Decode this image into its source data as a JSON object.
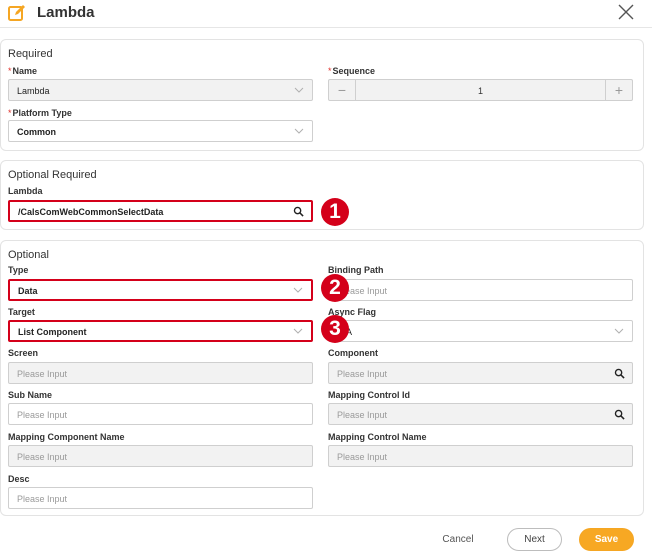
{
  "dialog": {
    "title": "Lambda"
  },
  "required": {
    "section_title": "Required",
    "name": {
      "label": "Name",
      "required_mark": "*",
      "value": "Lambda"
    },
    "sequence": {
      "label": "Sequence",
      "required_mark": "*",
      "value": "1",
      "minus": "−",
      "plus": "+"
    },
    "platform_type": {
      "label": "Platform Type",
      "required_mark": "*",
      "value": "Common"
    }
  },
  "optional_required": {
    "section_title": "Optional Required",
    "lambda": {
      "label": "Lambda",
      "value": "/CalsComWebCommonSelectData"
    }
  },
  "optional": {
    "section_title": "Optional",
    "type": {
      "label": "Type",
      "value": "Data"
    },
    "binding_path": {
      "label": "Binding Path",
      "placeholder": "Please Input"
    },
    "target": {
      "label": "Target",
      "value": "List Component"
    },
    "async_flag": {
      "label": "Async Flag",
      "value": "N/A"
    },
    "screen": {
      "label": "Screen",
      "placeholder": "Please Input"
    },
    "component": {
      "label": "Component",
      "placeholder": "Please Input"
    },
    "sub_name": {
      "label": "Sub Name",
      "placeholder": "Please Input"
    },
    "mapping_control_id": {
      "label": "Mapping Control Id",
      "placeholder": "Please Input"
    },
    "mapping_component_name": {
      "label": "Mapping Component Name",
      "placeholder": "Please Input"
    },
    "mapping_control_name": {
      "label": "Mapping Control Name",
      "placeholder": "Please Input"
    },
    "desc": {
      "label": "Desc",
      "placeholder": "Please Input"
    }
  },
  "annotations": {
    "marker_1": "1",
    "marker_2": "2",
    "marker_3": "3"
  },
  "footer": {
    "cancel_label": "Cancel",
    "next_label": "Next",
    "save_label": "Save"
  },
  "colors": {
    "accent": "#f7a823",
    "highlight": "#d4001a",
    "required": "#e0302a"
  },
  "icons": {
    "header": "edit-icon",
    "close": "close-icon",
    "dropdown": "chevron-down-icon",
    "search": "search-icon"
  }
}
